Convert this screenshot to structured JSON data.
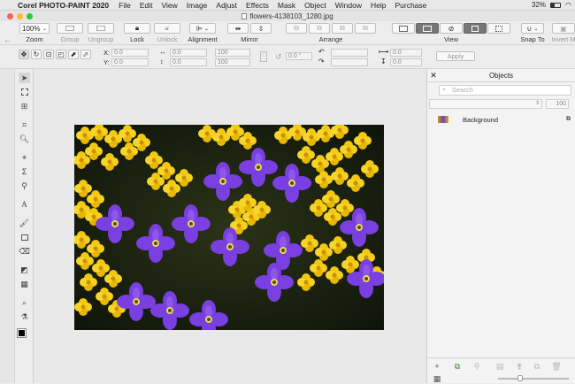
{
  "menubar": {
    "app_name": "Corel PHOTO-PAINT 2020",
    "items": [
      "File",
      "Edit",
      "View",
      "Image",
      "Adjust",
      "Effects",
      "Mask",
      "Object",
      "Window",
      "Help",
      "Purchase"
    ],
    "battery": "32%"
  },
  "window": {
    "title": "flowers-4138103_1280.jpg"
  },
  "toolbar": {
    "zoom_value": "100%",
    "zoom_label": "Zoom",
    "group_label": "Group",
    "ungroup_label": "Ungroup",
    "lock_label": "Lock",
    "unlock_label": "Unlock",
    "alignment_label": "Alignment",
    "mirror_label": "Mirror",
    "arrange_label": "Arrange",
    "view_label": "View",
    "snap_label": "Snap To",
    "invert_label": "Invert M"
  },
  "property_bar": {
    "x_label": "X:",
    "y_label": "Y:",
    "x_value": "0.0",
    "y_value": "0.0",
    "w_value": "0.0",
    "h_value": "0.0",
    "scale_w": "100",
    "scale_h": "100",
    "angle": "0.0 °",
    "skew_h": "0.0",
    "skew_v": "0.0",
    "apply_label": "Apply"
  },
  "objects_panel": {
    "title": "Objects",
    "search_placeholder": "Search",
    "opacity": "100",
    "object_name": "Background"
  },
  "colors": {
    "traffic_red": "#fc5f57",
    "traffic_yellow": "#fdbc2e",
    "traffic_green": "#28c840"
  }
}
